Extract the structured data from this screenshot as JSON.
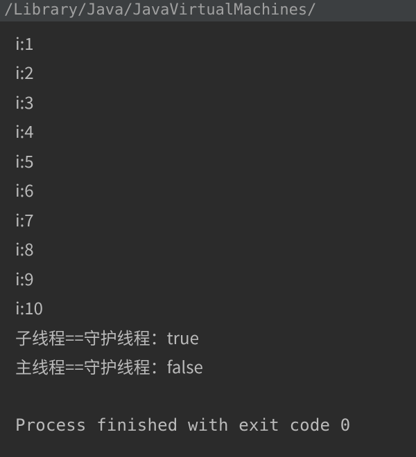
{
  "header": {
    "path": "/Library/Java/JavaVirtualMachines/"
  },
  "console": {
    "lines": [
      "i:1",
      "i:2",
      "i:3",
      "i:4",
      "i:5",
      "i:6",
      "i:7",
      "i:8",
      "i:9",
      "i:10",
      "子线程==守护线程：true",
      "主线程==守护线程：false"
    ],
    "processMessage": "Process finished with exit code 0"
  }
}
